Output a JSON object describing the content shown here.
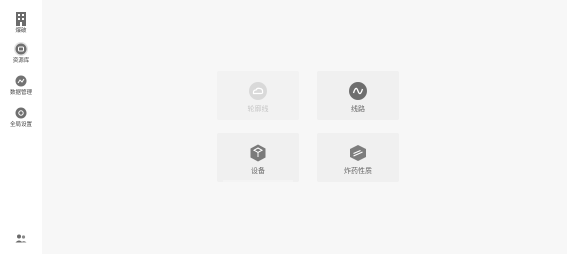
{
  "sidebar": {
    "items": [
      {
        "label": "爆破",
        "icon": "building-icon"
      },
      {
        "label": "资源库",
        "icon": "database-icon",
        "active": true
      },
      {
        "label": "数据管理",
        "icon": "chart-icon"
      },
      {
        "label": "全局设置",
        "icon": "settings-icon"
      }
    ],
    "bottom_icon": "users-icon"
  },
  "cards": [
    {
      "label": "轮廓线",
      "icon": "cloud-icon",
      "dim": true
    },
    {
      "label": "线路",
      "icon": "wave-icon"
    },
    {
      "label": "设备",
      "icon": "box-icon"
    },
    {
      "label": "炸药性质",
      "icon": "layers-icon"
    }
  ]
}
